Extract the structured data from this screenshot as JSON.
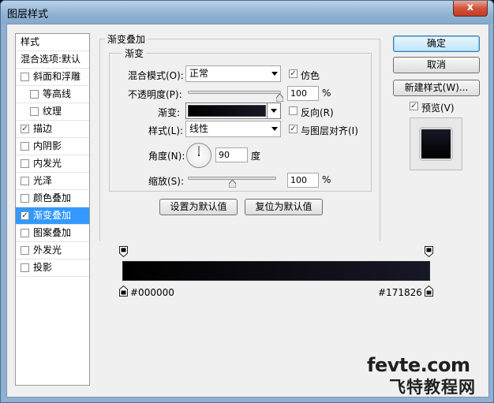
{
  "window": {
    "title": "图层样式",
    "close_label": "x"
  },
  "style_list": {
    "items": [
      {
        "label": "样式",
        "checkbox": false,
        "checked": false,
        "indent": false,
        "selected": false,
        "header": true
      },
      {
        "label": "混合选项:默认",
        "checkbox": false,
        "checked": false,
        "indent": false,
        "selected": false,
        "header": true
      },
      {
        "label": "斜面和浮雕",
        "checkbox": true,
        "checked": false,
        "indent": false,
        "selected": false
      },
      {
        "label": "等高线",
        "checkbox": true,
        "checked": false,
        "indent": true,
        "selected": false
      },
      {
        "label": "纹理",
        "checkbox": true,
        "checked": false,
        "indent": true,
        "selected": false
      },
      {
        "label": "描边",
        "checkbox": true,
        "checked": true,
        "indent": false,
        "selected": false
      },
      {
        "label": "内阴影",
        "checkbox": true,
        "checked": false,
        "indent": false,
        "selected": false
      },
      {
        "label": "内发光",
        "checkbox": true,
        "checked": false,
        "indent": false,
        "selected": false
      },
      {
        "label": "光泽",
        "checkbox": true,
        "checked": false,
        "indent": false,
        "selected": false
      },
      {
        "label": "颜色叠加",
        "checkbox": true,
        "checked": false,
        "indent": false,
        "selected": false
      },
      {
        "label": "渐变叠加",
        "checkbox": true,
        "checked": true,
        "indent": false,
        "selected": true
      },
      {
        "label": "图案叠加",
        "checkbox": true,
        "checked": false,
        "indent": false,
        "selected": false
      },
      {
        "label": "外发光",
        "checkbox": true,
        "checked": false,
        "indent": false,
        "selected": false
      },
      {
        "label": "投影",
        "checkbox": true,
        "checked": false,
        "indent": false,
        "selected": false
      }
    ]
  },
  "panel": {
    "outer_title": "渐变叠加",
    "inner_title": "渐变",
    "blend_mode_label": "混合模式(O):",
    "blend_mode_value": "正常",
    "dither_label": "仿色",
    "dither_checked": true,
    "opacity_label": "不透明度(P):",
    "opacity_value": "100",
    "opacity_unit": "%",
    "opacity_level": 1.0,
    "gradient_label": "渐变:",
    "reverse_label": "反向(R)",
    "reverse_checked": false,
    "style_label": "样式(L):",
    "style_value": "线性",
    "align_label": "与图层对齐(I)",
    "align_checked": true,
    "angle_label": "角度(N):",
    "angle_value": "90",
    "angle_unit": "度",
    "scale_label": "缩放(S):",
    "scale_value": "100",
    "scale_unit": "%",
    "scale_level": 0.5,
    "make_default_label": "设置为默认值",
    "reset_default_label": "复位为默认值"
  },
  "right": {
    "ok_label": "确定",
    "cancel_label": "取消",
    "new_style_label": "新建样式(W)...",
    "preview_label": "预览(V)",
    "preview_checked": true
  },
  "gradient_bar": {
    "start_color": "#000000",
    "end_color": "#171826",
    "start_label": "#000000",
    "end_label": "#171826"
  },
  "watermark": {
    "line1": "fevte.com",
    "line2": "飞特教程网"
  },
  "colors": {
    "accent": "#3399ff",
    "window_frame": "#8fb0d0",
    "close": "#c23b24"
  }
}
